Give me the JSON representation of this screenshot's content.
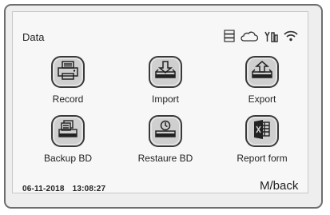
{
  "screen": {
    "title": "Data"
  },
  "status_icons": [
    "storage-icon",
    "cloud-icon",
    "antenna-icon",
    "wifi-icon"
  ],
  "tiles": [
    {
      "label": "Record",
      "icon": "printer-icon"
    },
    {
      "label": "Import",
      "icon": "import-tray-icon"
    },
    {
      "label": "Export",
      "icon": "export-tray-icon"
    },
    {
      "label": "Backup BD",
      "icon": "backup-database-icon"
    },
    {
      "label": "Restaure BD",
      "icon": "restore-database-icon"
    },
    {
      "label": "Report form",
      "icon": "excel-report-icon"
    }
  ],
  "footer": {
    "date": "06-11-2018",
    "time": "13:08:27",
    "back_label": "M/back"
  }
}
